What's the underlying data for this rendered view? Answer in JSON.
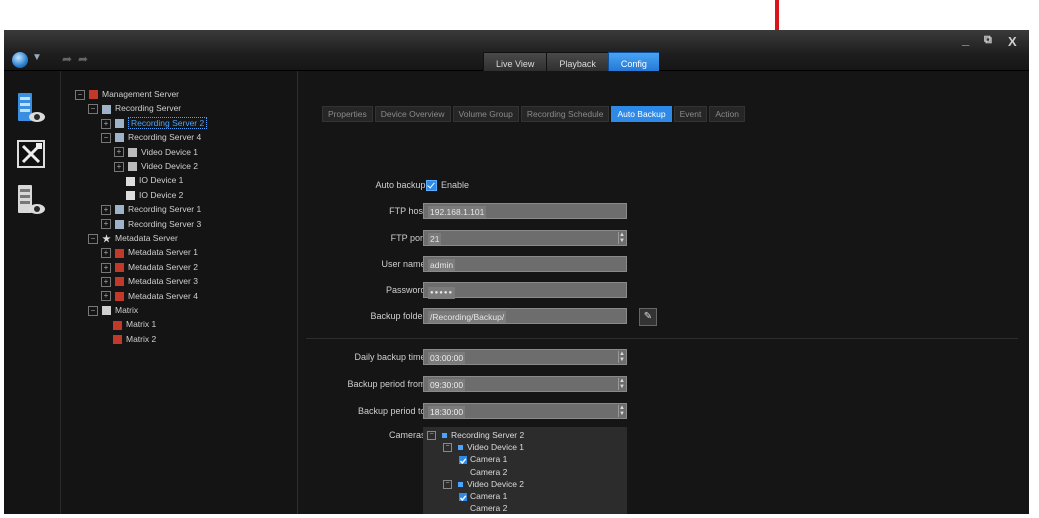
{
  "window": {
    "mode_tabs": [
      {
        "label": "Live View",
        "active": false
      },
      {
        "label": "Playback",
        "active": false
      },
      {
        "label": "Config",
        "active": true
      }
    ],
    "controls": {
      "minimize": "_",
      "restore": "⧉",
      "close": "X"
    }
  },
  "left_rail": {
    "icons": [
      "server-monitor-icon",
      "tools-icon",
      "server-eye-icon"
    ]
  },
  "tree": [
    {
      "label": "Management Server",
      "level": 0,
      "expander": "⊟",
      "icon": "red-server-icon"
    },
    {
      "label": "Recording Server",
      "level": 1,
      "expander": "⊟",
      "icon": "server-icon"
    },
    {
      "label": "Recording Server 2",
      "level": 2,
      "expander": "⊞",
      "icon": "server-icon",
      "selected": true
    },
    {
      "label": "Recording Server 4",
      "level": 2,
      "expander": "⊟",
      "icon": "server-icon"
    },
    {
      "label": "Video Device 1",
      "level": 3,
      "expander": "⊞",
      "icon": "camera-icon"
    },
    {
      "label": "Video Device 2",
      "level": 3,
      "expander": "⊞",
      "icon": "camera-icon"
    },
    {
      "label": "IO Device 1",
      "level": 3,
      "expander": "",
      "icon": "io-icon"
    },
    {
      "label": "IO Device 2",
      "level": 3,
      "expander": "",
      "icon": "io-icon"
    },
    {
      "label": "Recording Server 1",
      "level": 2,
      "expander": "⊞",
      "icon": "server-icon"
    },
    {
      "label": "Recording Server 3",
      "level": 2,
      "expander": "⊞",
      "icon": "server-icon"
    },
    {
      "label": "Metadata Server",
      "level": 1,
      "expander": "⊟",
      "icon": "star-icon"
    },
    {
      "label": "Metadata Server 1",
      "level": 2,
      "expander": "⊞",
      "icon": "red-server-icon"
    },
    {
      "label": "Metadata Server 2",
      "level": 2,
      "expander": "⊞",
      "icon": "red-server-icon"
    },
    {
      "label": "Metadata Server 3",
      "level": 2,
      "expander": "⊞",
      "icon": "red-server-icon"
    },
    {
      "label": "Metadata Server 4",
      "level": 2,
      "expander": "⊞",
      "icon": "red-server-icon"
    },
    {
      "label": "Matrix",
      "level": 1,
      "expander": "⊟",
      "icon": "matrix-icon"
    },
    {
      "label": "Matrix 1",
      "level": 2,
      "expander": "",
      "icon": "red-server-icon"
    },
    {
      "label": "Matrix 2",
      "level": 2,
      "expander": "",
      "icon": "red-server-icon"
    }
  ],
  "sub_tabs": [
    {
      "label": "Properties",
      "active": false
    },
    {
      "label": "Device Overview",
      "active": false
    },
    {
      "label": "Volume Group",
      "active": false
    },
    {
      "label": "Recording Schedule",
      "active": false
    },
    {
      "label": "Auto Backup",
      "active": true
    },
    {
      "label": "Event",
      "active": false
    },
    {
      "label": "Action",
      "active": false
    }
  ],
  "form": {
    "auto_backup_label": "Auto backup:",
    "enable_label": "Enable",
    "enable_checked": true,
    "ftp_host_label": "FTP host:",
    "ftp_host_value": "192.168.1.101",
    "ftp_port_label": "FTP port:",
    "ftp_port_value": "21",
    "user_name_label": "User name:",
    "user_name_value": "admin",
    "password_label": "Password:",
    "password_value": "●●●●●",
    "backup_folder_label": "Backup folder:",
    "backup_folder_value": "/Recording/Backup/",
    "daily_backup_time_label": "Daily backup time:",
    "daily_backup_time_value": "03:00:00",
    "backup_period_from_label": "Backup period from:",
    "backup_period_from_value": "09:30:00",
    "backup_period_to_label": "Backup period to:",
    "backup_period_to_value": "18:30:00",
    "cameras_label": "Cameras:"
  },
  "cameras_tree": [
    {
      "label": "Recording Server 2",
      "level": 0,
      "expander": "⊟",
      "mark": "dot"
    },
    {
      "label": "Video Device 1",
      "level": 1,
      "expander": "⊟",
      "mark": "dot"
    },
    {
      "label": "Camera 1",
      "level": 2,
      "expander": "",
      "mark": "checked"
    },
    {
      "label": "Camera 2",
      "level": 2,
      "expander": "",
      "mark": "none"
    },
    {
      "label": "Video Device 2",
      "level": 1,
      "expander": "⊟",
      "mark": "dot"
    },
    {
      "label": "Camera 1",
      "level": 2,
      "expander": "",
      "mark": "checked"
    },
    {
      "label": "Camera 2",
      "level": 2,
      "expander": "",
      "mark": "none"
    }
  ],
  "colors": {
    "accent_blue": "#2e8ae6",
    "annotation_red": "#d9141b",
    "app_background": "#151515"
  }
}
